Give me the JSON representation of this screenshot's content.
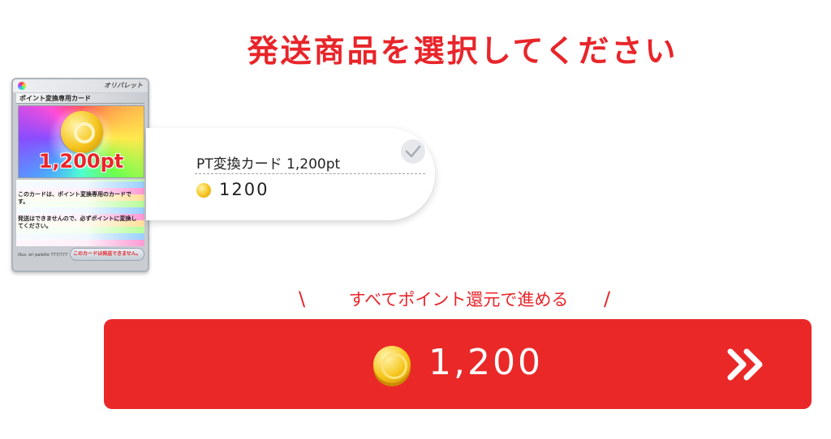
{
  "page": {
    "title": "発送商品を選択してください"
  },
  "card": {
    "brand": "オリパレット",
    "name": "ポイント変換専用カード",
    "art_value": "1,200pt",
    "description_1": "このカードは、ポイント変換専用のカードです。",
    "description_2": "発送はできませんので、必ずポイントに変換してください。",
    "footer_left": "illus. ori palette 777/777",
    "footer_notice": "このカードは発送できません。"
  },
  "selection": {
    "item_name": "PT変換カード 1,200pt",
    "points": "1200",
    "icons": {
      "coin": "coin-icon",
      "check": "check-icon"
    }
  },
  "redeem": {
    "caption": "すべてポイント還元で進める",
    "slash_left": "\\",
    "slash_right": "/",
    "button_points": "1,200",
    "icons": {
      "coin": "coin-icon",
      "arrow": "double-chevron-right-icon"
    }
  },
  "colors": {
    "accent": "#e8252a",
    "button": "#ea2828",
    "coin": "#f6c61d"
  }
}
